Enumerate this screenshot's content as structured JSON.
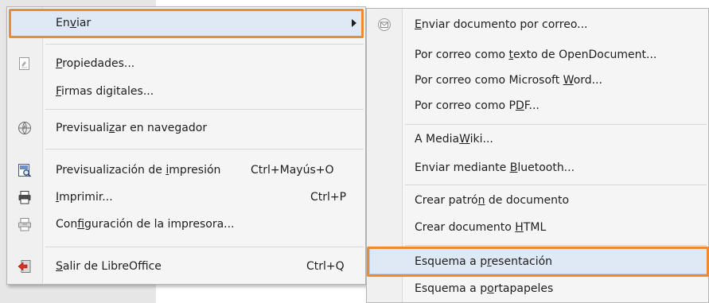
{
  "main_menu": {
    "items": [
      {
        "pre": "En",
        "u": "v",
        "post": "iar",
        "shortcut": ""
      },
      {
        "pre": "",
        "u": "P",
        "post": "ropiedades...",
        "shortcut": ""
      },
      {
        "pre": "",
        "u": "F",
        "post": "irmas digitales...",
        "shortcut": ""
      },
      {
        "pre": "Previsuali",
        "u": "z",
        "post": "ar en navegador",
        "shortcut": ""
      },
      {
        "pre": "Previsualización de ",
        "u": "i",
        "post": "mpresión",
        "shortcut": "Ctrl+Mayús+O"
      },
      {
        "pre": "",
        "u": "I",
        "post": "mprimir...",
        "shortcut": "Ctrl+P"
      },
      {
        "pre": "Con",
        "u": "f",
        "post": "iguración de la impresora...",
        "shortcut": ""
      },
      {
        "pre": "",
        "u": "S",
        "post": "alir de LibreOffice",
        "shortcut": "Ctrl+Q"
      }
    ],
    "icons": [
      "submenu-arrow-icon",
      "properties-icon",
      "web-preview-icon",
      "print-preview-icon",
      "printer-icon",
      "printer-settings-icon",
      "exit-icon"
    ]
  },
  "submenu": {
    "items": [
      {
        "pre": "",
        "u": "E",
        "post": "nviar documento por correo..."
      },
      {
        "pre": "Por correo como ",
        "u": "t",
        "post": "exto de OpenDocument..."
      },
      {
        "pre": "Por correo como Microsoft ",
        "u": "W",
        "post": "ord..."
      },
      {
        "pre": "Por correo como P",
        "u": "D",
        "post": "F..."
      },
      {
        "pre": "A Media",
        "u": "W",
        "post": "iki..."
      },
      {
        "pre": "Enviar mediante ",
        "u": "B",
        "post": "luetooth..."
      },
      {
        "pre": "Crear patró",
        "u": "n",
        "post": " de documento"
      },
      {
        "pre": "Crear documento ",
        "u": "H",
        "post": "TML"
      },
      {
        "pre": "Esquema a p",
        "u": "r",
        "post": "esentación"
      },
      {
        "pre": "Esquema a p",
        "u": "o",
        "post": "rtapapeles"
      }
    ],
    "icons": [
      "email-icon"
    ]
  },
  "colors": {
    "highlight_border": "#f08a2c",
    "hover_fill": "#dfe8f5",
    "menu_bg": "#f5f5f5"
  }
}
